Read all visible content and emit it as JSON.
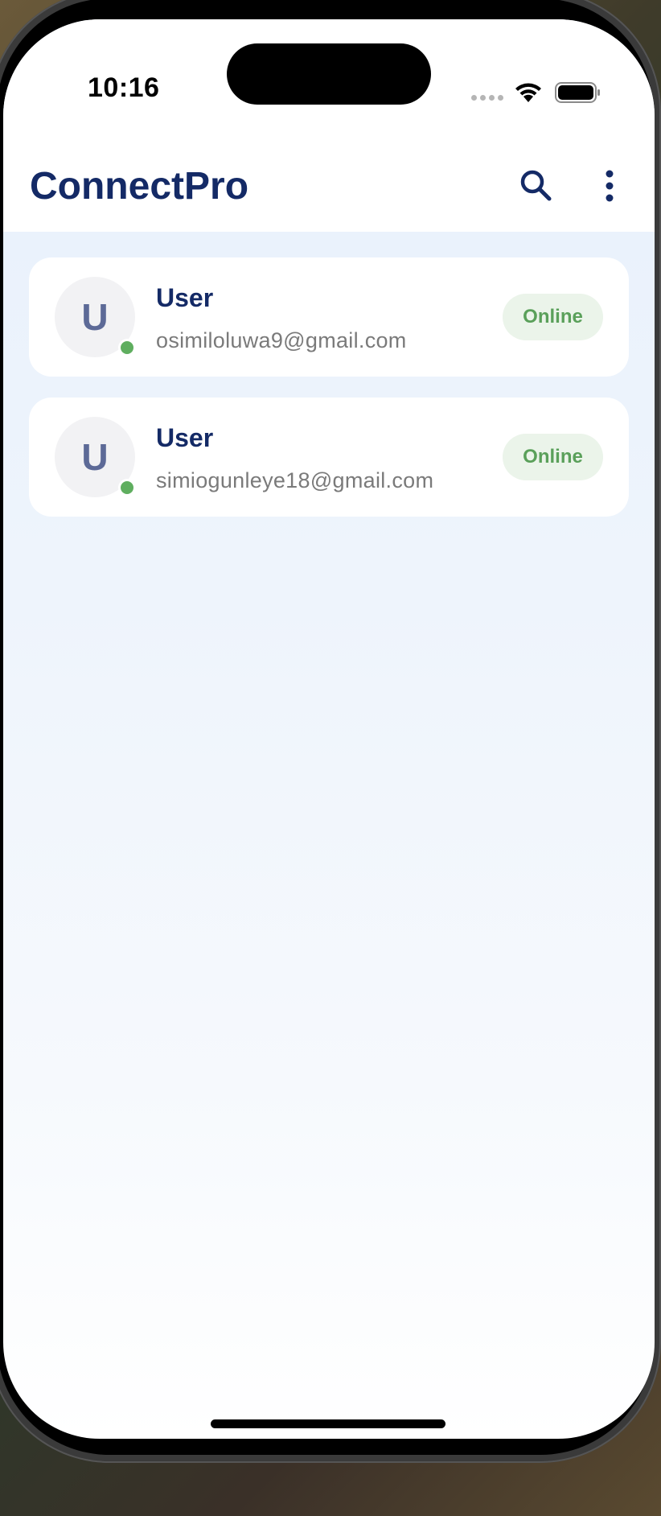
{
  "status_bar": {
    "time": "10:16",
    "icons": [
      "cellular-signal-icon",
      "wifi-icon",
      "battery-icon"
    ]
  },
  "app_bar": {
    "title": "ConnectPro",
    "actions": [
      "search-icon",
      "more-vert-icon"
    ]
  },
  "users": [
    {
      "avatar_letter": "U",
      "name": "User",
      "email": "osimiloluwa9@gmail.com",
      "status": "Online"
    },
    {
      "avatar_letter": "U",
      "name": "User",
      "email": "simiogunleye18@gmail.com",
      "status": "Online"
    }
  ],
  "colors": {
    "brand": "#142a66",
    "online": "#5fae5f",
    "online_badge_bg": "#ebf4ea",
    "background": "#eef4fc"
  }
}
